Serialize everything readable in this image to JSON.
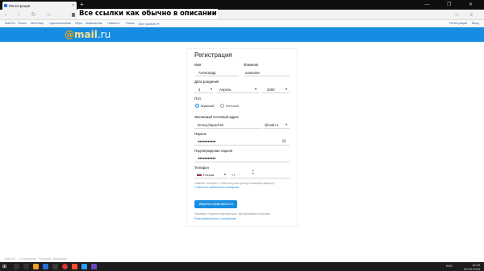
{
  "browser": {
    "tab_title": "Регистрация",
    "close_glyph": "×",
    "newtab_glyph": "+",
    "window_buttons": "— ❐ ✕",
    "nav_glyphs": "‹ › ↻ ⌂",
    "tool_glyphs": "☆ ≡"
  },
  "overlay_caption": "Все ссылки как обычно в описании",
  "portal_links": [
    "Mail.Ru",
    "Почта",
    "Мой Мир",
    "Одноклассники",
    "Игры",
    "Знакомства",
    "Новости",
    "Поиск",
    "Все проекты ▾"
  ],
  "portal_right": [
    "Регистрация",
    "Вход"
  ],
  "logo": {
    "at": "@",
    "mail": "mail",
    "ru": ".ru"
  },
  "form": {
    "title": "Регистрация",
    "first_name_label": "Имя",
    "first_name_value": "Александр",
    "last_name_label": "Фамилия",
    "last_name_value": "шапилин",
    "dob_label": "Дата рождения",
    "dob_day": "3",
    "dob_month": "Апрель",
    "dob_year": "2000",
    "gender_label": "Пол",
    "gender_male": "Мужской",
    "gender_female": "Женский",
    "email_label": "Желаемый почтовый адрес",
    "email_value": "lenony.bapochek",
    "email_domain": "@mail.ru",
    "password_label": "Пароль",
    "password_value": "●●●●●●●●●●●",
    "password_confirm_label": "Подтверждение пароля",
    "password_confirm_value": "●●●●●●●●●●●",
    "phone_label": "Телефон",
    "phone_country": "Россия",
    "phone_code": "+7",
    "phone_hint": "Укажите телефон, чтобы получить доступ к вашему аккаунту",
    "no_phone_link": "У меня нет мобильного телефона",
    "submit_label": "Зарегистрироваться",
    "terms_text": "Нажимая «Зарегистрироваться», вы принимаете условия",
    "terms_link": "Пользовательского соглашения"
  },
  "footer_links": [
    "Mail.Ru",
    "О компании",
    "Реклама",
    "Вакансии"
  ],
  "taskbar": {
    "time": "14:09",
    "date": "09.04.2019",
    "lang": "ENG"
  },
  "colors": {
    "header": "#168de2",
    "accent": "#168de2",
    "tabbar": "#0f0f0f"
  }
}
